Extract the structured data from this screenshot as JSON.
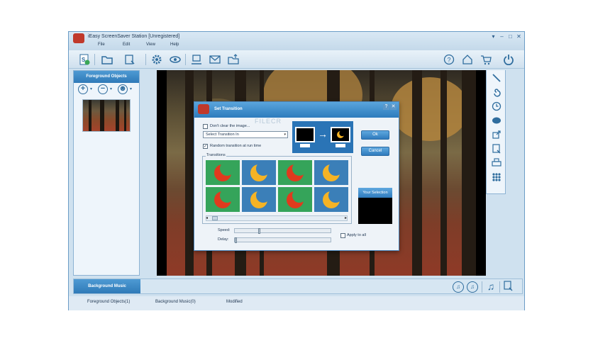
{
  "window": {
    "title": "iEasy ScreenSaver Station [Unregistered]",
    "controls": {
      "minimize": "▾",
      "restore": "–",
      "maximize": "□",
      "close": "✕"
    }
  },
  "menu": [
    "File",
    "Edit",
    "View",
    "Help"
  ],
  "toolbar": {
    "icons": [
      "new-project-icon",
      "open-folder-icon",
      "save-icon",
      "settings-gear-icon",
      "preview-eye-icon",
      "build-export-icon",
      "email-icon",
      "publish-folder-icon",
      "help-icon",
      "home-icon",
      "cart-icon",
      "power-icon"
    ]
  },
  "left_panel": {
    "header": "Foreground Objects",
    "tools": {
      "add": "+",
      "remove": "−",
      "person": "☻",
      "dropdown": "▾"
    }
  },
  "bottom": {
    "music_header": "Background Music",
    "icons": [
      "music-add-icon",
      "music-remove-icon",
      "music-note-icon",
      "music-export-icon"
    ]
  },
  "status": {
    "foreground": "Foreground Objects(1)",
    "music": "Background Music(0)",
    "modified": "Modified"
  },
  "dialog": {
    "title": "Set Transition",
    "help": "?",
    "close": "✕",
    "watermark": "FILECR",
    "dont_clear_label": "Don't clear the image...",
    "dont_clear_checked": false,
    "transition_select": "Select Transition In",
    "random_label": "Random transition at run time",
    "random_checked": "✓",
    "ok": "Ok",
    "cancel": "Cancel",
    "transitions_label": "Transitions",
    "your_selection": "Your Selection",
    "speed_label": "Speed:",
    "delay_label": "Delay:",
    "apply_all_label": "Apply to all",
    "speed_value": 0.25,
    "delay_value": 0.0,
    "scroll_left": "◂",
    "scroll_right": "▸",
    "select_arrow": "▾"
  },
  "colors": {
    "accent": "#2f7bbd",
    "moon_red": "#e03a1e",
    "moon_yellow": "#f5b325",
    "tile_green": "#35a45a",
    "tile_blue": "#3b7fb8"
  }
}
